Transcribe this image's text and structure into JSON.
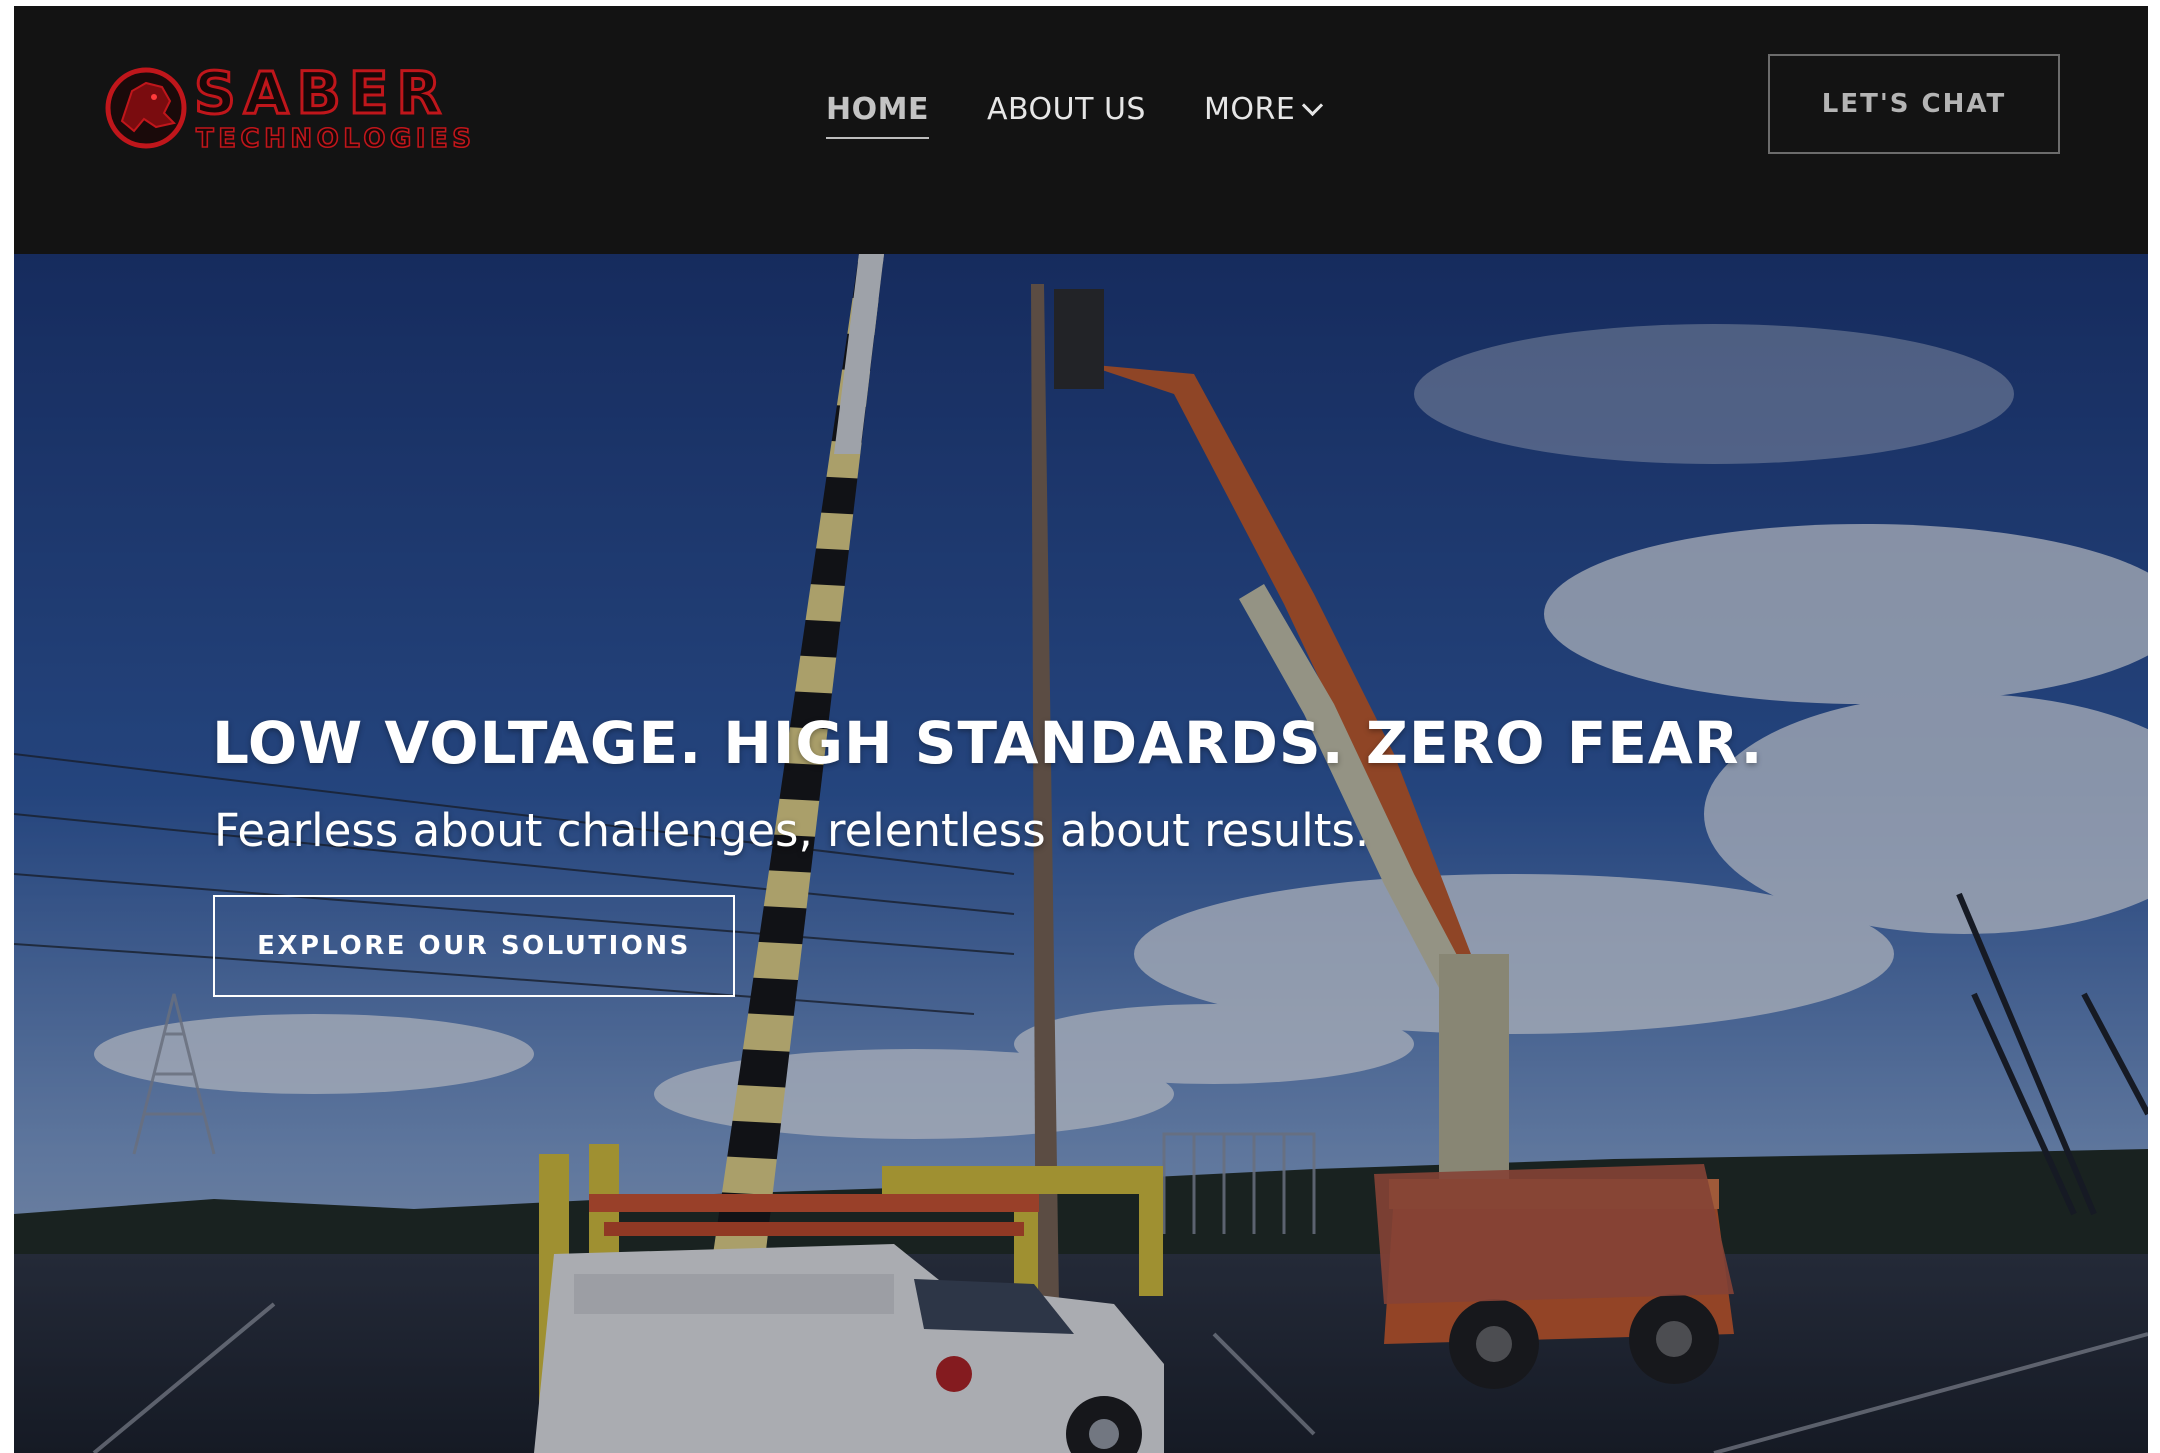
{
  "brand": {
    "logo_word": "SABER",
    "logo_sub": "TECHNOLOGIES"
  },
  "nav": {
    "items": [
      {
        "label": "HOME",
        "active": true
      },
      {
        "label": "ABOUT US",
        "active": false
      },
      {
        "label": "MORE",
        "active": false
      }
    ]
  },
  "header": {
    "cta_label": "LET'S CHAT"
  },
  "hero": {
    "headline": "LOW VOLTAGE. HIGH STANDARDS. ZERO FEAR.",
    "subheadline": "Fearless about challenges, relentless about results.",
    "button_label": "EXPLORE OUR SOLUTIONS"
  },
  "colors": {
    "header_bg": "#131313",
    "logo_red": "#c0161b",
    "sky_top": "#1c3a7a",
    "sky_bottom": "#6f93c9"
  }
}
